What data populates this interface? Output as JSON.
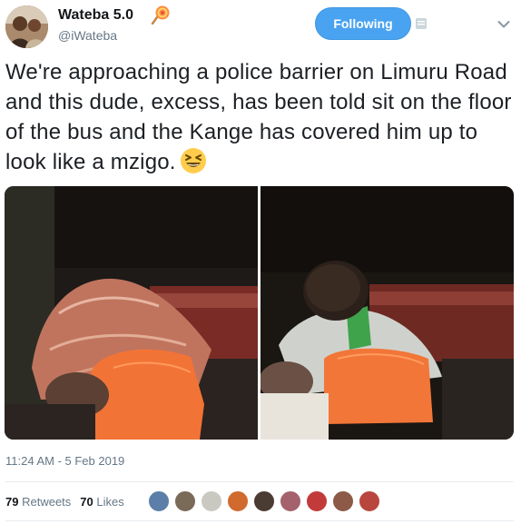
{
  "author": {
    "display_name": "Wateba 5.0",
    "handle": "@iWateba",
    "badge_icon": "lollipop-icon",
    "avatar_icon": "profile-photo-icon"
  },
  "follow_button": {
    "label": "Following",
    "color": "#4aa3f0"
  },
  "tweet": {
    "text": "We're approaching a police barrier on Limuru Road and this dude, excess, has been told sit on the floor of the bus and the Kange has covered him up to look like a mzigo.",
    "emoji": "laughing-face-emoji"
  },
  "media": [
    {
      "icon": "photo-man-covered-with-cloth"
    },
    {
      "icon": "photo-man-crouching-on-bus-floor"
    }
  ],
  "timestamp": "11:24 AM - 5 Feb 2019",
  "stats": {
    "retweets_count": "79",
    "retweets_label": "Retweets",
    "likes_count": "70",
    "likes_label": "Likes"
  },
  "likers": {
    "count": 9,
    "icon": "liker-avatar-icon"
  },
  "colors": {
    "text": "#14171a",
    "secondary": "#657786",
    "divider": "#e6ecf0"
  }
}
